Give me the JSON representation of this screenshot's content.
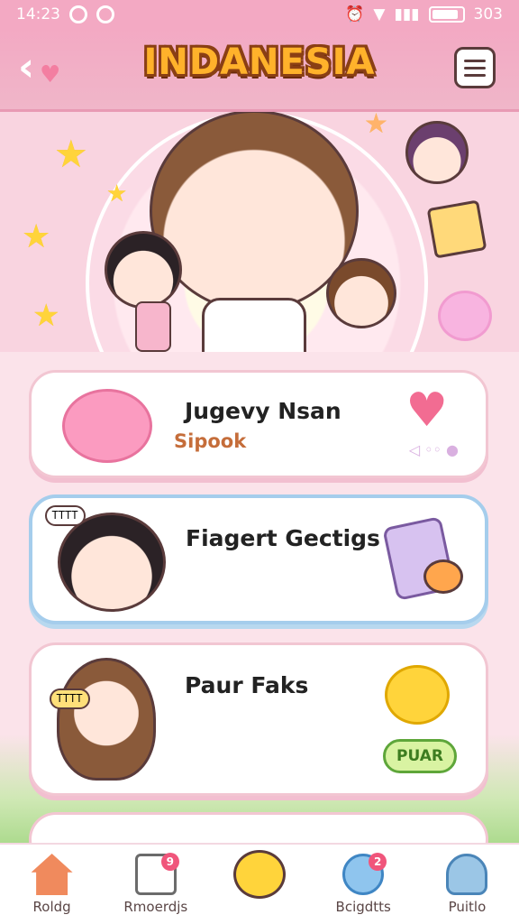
{
  "status_bar": {
    "time": "14:23",
    "battery": "303"
  },
  "header": {
    "title": "INDANESIA"
  },
  "cards": [
    {
      "title": "Jugevy Nsan",
      "subtitle": "Sipook"
    },
    {
      "title": "Fiagert Gectigs",
      "bubble": "ᎢᎢᎢᎢ"
    },
    {
      "title": "Paur Faks",
      "bubble": "ᎢᎢᎢᎢ",
      "button": "PUAR"
    }
  ],
  "nav": {
    "items": [
      {
        "label": "Roldg"
      },
      {
        "label": "Rmoerdjs",
        "badge": "9"
      },
      {
        "label": ""
      },
      {
        "label": "Bcigdtts",
        "badge": "2"
      },
      {
        "label": "Puitlo"
      }
    ]
  },
  "colors": {
    "header_pink": "#f3a9c3",
    "title_orange": "#ffb22b",
    "card_blue_border": "#a5cdec",
    "button_green": "#d9f3a2"
  },
  "icons": [
    "back-arrow-icon",
    "heart-icon",
    "menu-icon",
    "wifi-icon",
    "battery-icon",
    "home-icon",
    "gift-icon",
    "smile-icon",
    "chat-icon",
    "profile-icon"
  ]
}
